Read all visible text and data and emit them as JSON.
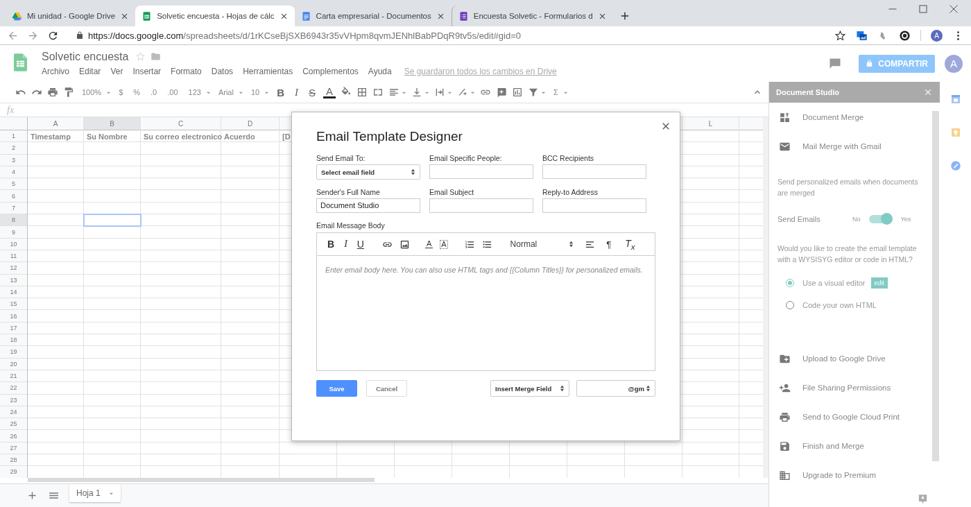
{
  "browser": {
    "tabs": [
      {
        "title": "Mi unidad - Google Drive",
        "kind": "drive",
        "selected": false
      },
      {
        "title": "Solvetic encuesta - Hojas de cálc",
        "kind": "sheets",
        "selected": true
      },
      {
        "title": "Carta empresarial - Documentos",
        "kind": "docs",
        "selected": false
      },
      {
        "title": "Encuesta Solvetic - Formularios d",
        "kind": "forms",
        "selected": false
      }
    ],
    "url_host": "https://docs.google.com",
    "url_path": "/spreadsheets/d/1rKCseBjSXB6943r35vVHpm8qvmJENhlBabPDqR9tv5s/edit#gid=0",
    "profile_initial": "A"
  },
  "document": {
    "title": "Solvetic encuesta",
    "menu": [
      "Archivo",
      "Editar",
      "Ver",
      "Insertar",
      "Formato",
      "Datos",
      "Herramientas",
      "Complementos",
      "Ayuda"
    ],
    "save_status": "Se guardaron todos los cambios en Drive",
    "share_button": "COMPARTIR",
    "avatar_initial": "A"
  },
  "toolbar": [
    {
      "kind": "undo"
    },
    {
      "kind": "redo"
    },
    {
      "kind": "print"
    },
    {
      "kind": "paint"
    },
    {
      "kind": "text",
      "text": "100%",
      "caret": true
    },
    {
      "kind": "text",
      "text": "$"
    },
    {
      "kind": "text",
      "text": "%"
    },
    {
      "kind": "text",
      "text": ".0"
    },
    {
      "kind": "text",
      "text": ".00"
    },
    {
      "kind": "text",
      "text": "123",
      "caret": true
    },
    {
      "kind": "text",
      "text": "Arial",
      "caret": true
    },
    {
      "kind": "text",
      "text": "10",
      "caret": true
    },
    {
      "kind": "bold",
      "text": "B"
    },
    {
      "kind": "italic",
      "text": "I"
    },
    {
      "kind": "strike",
      "text": "S"
    },
    {
      "kind": "color",
      "text": "A"
    },
    {
      "kind": "fill"
    },
    {
      "kind": "borders"
    },
    {
      "kind": "merge"
    },
    {
      "kind": "align",
      "caret": true
    },
    {
      "kind": "valign",
      "caret": true
    },
    {
      "kind": "wrap",
      "caret": true
    },
    {
      "kind": "rotate",
      "caret": true
    },
    {
      "kind": "link"
    },
    {
      "kind": "comment"
    },
    {
      "kind": "chart"
    },
    {
      "kind": "filter",
      "caret": true
    },
    {
      "kind": "text",
      "text": "Σ",
      "caret": true
    }
  ],
  "formula_label": "fx",
  "grid": {
    "columns": [
      {
        "label": "A",
        "selected": false
      },
      {
        "label": "B",
        "selected": true
      },
      {
        "label": "C",
        "selected": false
      },
      {
        "label": "D",
        "selected": false
      },
      {
        "label": "L",
        "selected": false
      }
    ],
    "header_row": [
      "Timestamp",
      "Su Nombre",
      "Su correo electronico",
      "Acuerdo",
      "[D"
    ],
    "rows": [
      {
        "number": "1",
        "selected": false
      },
      {
        "number": "2",
        "selected": false
      },
      {
        "number": "3",
        "selected": false
      },
      {
        "number": "4",
        "selected": false
      },
      {
        "number": "5",
        "selected": false
      },
      {
        "number": "6",
        "selected": false
      },
      {
        "number": "7",
        "selected": false
      },
      {
        "number": "8",
        "selected": true
      },
      {
        "number": "9",
        "selected": false
      },
      {
        "number": "10",
        "selected": false
      },
      {
        "number": "11",
        "selected": false
      },
      {
        "number": "12",
        "selected": false
      },
      {
        "number": "13",
        "selected": false
      },
      {
        "number": "14",
        "selected": false
      },
      {
        "number": "15",
        "selected": false
      },
      {
        "number": "16",
        "selected": false
      },
      {
        "number": "17",
        "selected": false
      },
      {
        "number": "18",
        "selected": false
      },
      {
        "number": "19",
        "selected": false
      },
      {
        "number": "20",
        "selected": false
      },
      {
        "number": "21",
        "selected": false
      },
      {
        "number": "22",
        "selected": false
      },
      {
        "number": "23",
        "selected": false
      },
      {
        "number": "24",
        "selected": false
      },
      {
        "number": "25",
        "selected": false
      },
      {
        "number": "26",
        "selected": false
      },
      {
        "number": "27",
        "selected": false
      },
      {
        "number": "28",
        "selected": false
      },
      {
        "number": "29",
        "selected": false
      }
    ]
  },
  "sheet_tabs": [
    {
      "name": "Hoja 1",
      "selected": true
    }
  ],
  "dialog": {
    "title": "Email Template Designer",
    "fields": [
      {
        "label": "Send Email To:",
        "kind": "select",
        "value": "Select email field"
      },
      {
        "label": "Email Specific People:",
        "kind": "text"
      },
      {
        "label": "BCC Recipients",
        "kind": "text"
      },
      {
        "label": "Sender's Full Name",
        "kind": "text",
        "value": "Document Studio"
      },
      {
        "label": "Email Subject",
        "kind": "text"
      },
      {
        "label": "Reply-to Address",
        "kind": "text"
      }
    ],
    "body_label": "Email Message Body",
    "editor_tools": [
      {
        "kind": "bold",
        "text": "B"
      },
      {
        "kind": "italic",
        "text": "I"
      },
      {
        "kind": "underline",
        "text": "U"
      },
      {
        "kind": "link"
      },
      {
        "kind": "image"
      },
      {
        "kind": "color",
        "text": "A"
      },
      {
        "kind": "highlight",
        "text": "A"
      },
      {
        "kind": "ol"
      },
      {
        "kind": "ul"
      },
      {
        "kind": "select",
        "text": "Normal"
      },
      {
        "kind": "align"
      },
      {
        "kind": "direction",
        "text": "¶"
      },
      {
        "kind": "clear",
        "text": "T$_{x}$"
      }
    ],
    "body_placeholder": "Enter email body here. You can also use HTML tags and {{Column Titles}} for personalized emails.",
    "buttons": [
      {
        "label": "Save",
        "kind": "primary"
      },
      {
        "label": "Cancel",
        "kind": "secondary"
      }
    ],
    "merge_select": "Insert Merge Field",
    "domain_select": "@gm"
  },
  "sidebar": {
    "title": "Document Studio",
    "sections": [
      {
        "kind": "item",
        "label": "Document Merge"
      },
      {
        "kind": "item",
        "label": "Mail Merge with Gmail"
      },
      {
        "kind": "note",
        "text": "Send personalized emails when documents are merged"
      },
      {
        "kind": "toggle",
        "label": "Send Emails",
        "off_label": "No",
        "on_label": "Yes",
        "on": true
      },
      {
        "kind": "note",
        "text": "Would you like to create the email template with a WYSISYG editor or code in HTML?"
      },
      {
        "kind": "radio",
        "label": "Use a visual editor",
        "selected": true,
        "badge": "edit"
      },
      {
        "kind": "radio",
        "label": "Code your own HTML",
        "selected": false
      },
      {
        "kind": "item",
        "label": "Upload to Google Drive"
      },
      {
        "kind": "item",
        "label": "File Sharing Permissions"
      },
      {
        "kind": "item",
        "label": "Send to Google Cloud Print"
      },
      {
        "kind": "item",
        "label": "Finish and Merge"
      },
      {
        "kind": "item",
        "label": "Upgrade to Premium"
      }
    ]
  }
}
